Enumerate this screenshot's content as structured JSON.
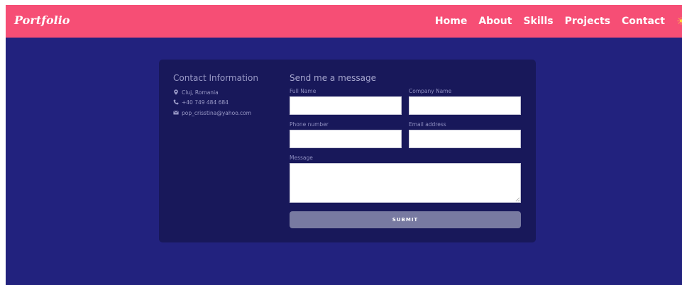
{
  "navbar": {
    "brand": "Portfolio",
    "links": [
      "Home",
      "About",
      "Skills",
      "Projects",
      "Contact"
    ],
    "theme_toggle_icon": "sun-icon",
    "background": "#f64e75"
  },
  "contact_info": {
    "title": "Contact Information",
    "location": "Cluj, Romania",
    "phone": "+40 749 484 684",
    "email": "pop_crisstina@yahoo.com"
  },
  "form": {
    "title": "Send me a message",
    "full_name_label": "Full Name",
    "full_name_value": "",
    "company_label": "Company Name",
    "company_value": "",
    "phone_label": "Phone number",
    "phone_value": "",
    "email_label": "Email address",
    "email_value": "",
    "message_label": "Message",
    "message_value": "",
    "submit_label": "SUBMIT"
  },
  "colors": {
    "page_background": "#22227e",
    "card_background": "#18185a",
    "submit_button": "#787aa1"
  }
}
